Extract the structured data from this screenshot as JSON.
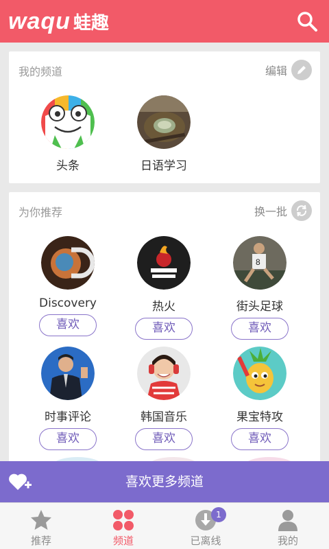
{
  "app": {
    "logo_en": "waqu",
    "logo_cn": "蛙趣",
    "search_icon": "search-icon",
    "brand_color": "#f25a68",
    "accent_color": "#7c6bcd"
  },
  "my_channels": {
    "title": "我的频道",
    "edit_label": "编辑",
    "items": [
      {
        "name": "头条",
        "icon": "frog-logo"
      },
      {
        "name": "日语学习",
        "icon": "tea-photo"
      }
    ]
  },
  "recommend": {
    "title": "为你推荐",
    "refresh_label": "换一批",
    "like_label": "喜欢",
    "items": [
      {
        "name": "Discovery",
        "icon": "discovery-logo"
      },
      {
        "name": "热火",
        "icon": "miami-heat-logo"
      },
      {
        "name": "街头足球",
        "icon": "street-soccer-photo"
      },
      {
        "name": "时事评论",
        "icon": "commentator-photo"
      },
      {
        "name": "韩国音乐",
        "icon": "girl-headphones-photo"
      },
      {
        "name": "果宝特攻",
        "icon": "cartoon-pineapple"
      }
    ]
  },
  "more_banner": {
    "label": "喜欢更多频道"
  },
  "bottom_nav": {
    "items": [
      {
        "label": "推荐",
        "icon": "star-icon",
        "active": false
      },
      {
        "label": "频道",
        "icon": "grid-dots-icon",
        "active": true
      },
      {
        "label": "已离线",
        "icon": "download-icon",
        "active": false,
        "badge": "1"
      },
      {
        "label": "我的",
        "icon": "person-icon",
        "active": false
      }
    ]
  }
}
